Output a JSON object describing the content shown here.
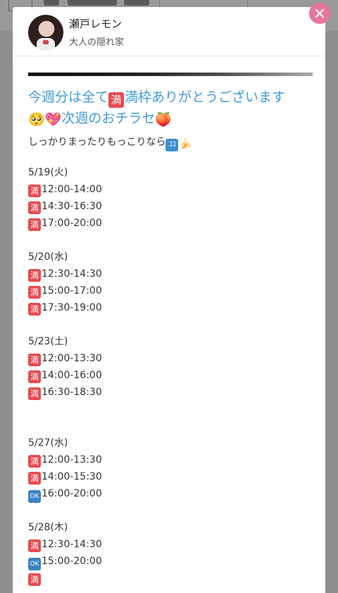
{
  "profile": {
    "name": "瀬戸レモン",
    "shop": "大人の隠れ家"
  },
  "post": {
    "headline_line1": "今週分は全て",
    "headline_badge": "満",
    "headline_line1_end": "満枠ありがとうございます",
    "headline_line2": "次週のおチラセ",
    "headline_emoji_before": "🥺💖",
    "headline_emoji_after": "🍑",
    "subline": "しっかりまったりもっこりなら",
    "subline_badge": "ｺｺ",
    "subline_emoji": "🍌",
    "days": [
      {
        "date": "5/19(火)",
        "slots": [
          {
            "status": "満",
            "time": "12:00-14:00"
          },
          {
            "status": "満",
            "time": "14:30-16:30"
          },
          {
            "status": "満",
            "time": "17:00-20:00"
          }
        ]
      },
      {
        "date": "5/20(水)",
        "slots": [
          {
            "status": "満",
            "time": "12:30-14:30"
          },
          {
            "status": "満",
            "time": "15:00-17:00"
          },
          {
            "status": "満",
            "time": "17:30-19:00"
          }
        ]
      },
      {
        "date": "5/23(土)",
        "slots": [
          {
            "status": "満",
            "time": "12:00-13:30"
          },
          {
            "status": "満",
            "time": "14:00-16:00"
          },
          {
            "status": "満",
            "time": "16:30-18:30"
          }
        ]
      },
      {
        "date": "5/27(水)",
        "slots": [
          {
            "status": "満",
            "time": "12:00-13:30"
          },
          {
            "status": "満",
            "time": "14:00-15:30"
          },
          {
            "status": "OK",
            "time": "16:00-20:00"
          }
        ]
      },
      {
        "date": "5/28(木)",
        "slots": [
          {
            "status": "満",
            "time": "12:30-14:30"
          },
          {
            "status": "OK",
            "time": "15:00-20:00"
          },
          {
            "status": "満",
            "time": ""
          }
        ]
      }
    ]
  },
  "colors": {
    "accent_text": "#3f9bd6",
    "close_button": "#e9759a",
    "full_badge": "#e9494e",
    "ok_badge": "#3b82c4"
  }
}
